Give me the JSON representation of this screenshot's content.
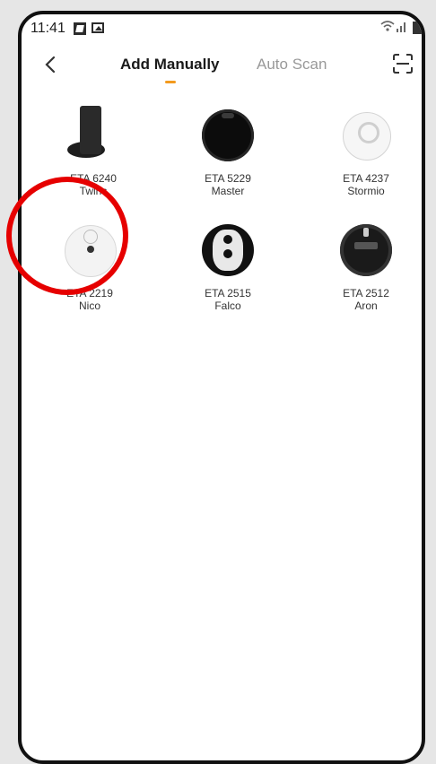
{
  "status_bar": {
    "time": "11:41",
    "icons": [
      "notification-icon",
      "gallery-icon",
      "wifi-icon",
      "signal-icon",
      "battery-icon"
    ]
  },
  "header": {
    "back_icon": "chevron-left-icon",
    "tabs": [
      {
        "label": "Add Manually",
        "active": true
      },
      {
        "label": "Auto Scan",
        "active": false
      }
    ],
    "scan_icon": "scan-frame-icon",
    "accent_color": "#f39a1e"
  },
  "devices": [
    {
      "model": "ETA 6240",
      "name": "Twins",
      "image": "robot-with-dock"
    },
    {
      "model": "ETA 5229",
      "name": "Master",
      "image": "black-robot"
    },
    {
      "model": "ETA 4237",
      "name": "Stormio",
      "image": "white-robot"
    },
    {
      "model": "ETA 2219",
      "name": "Nico",
      "image": "white-robot",
      "highlighted": true
    },
    {
      "model": "ETA 2515",
      "name": "Falco",
      "image": "falco-robot"
    },
    {
      "model": "ETA 2512",
      "name": "Aron",
      "image": "black-robot"
    }
  ],
  "highlight_color": "#e60000"
}
